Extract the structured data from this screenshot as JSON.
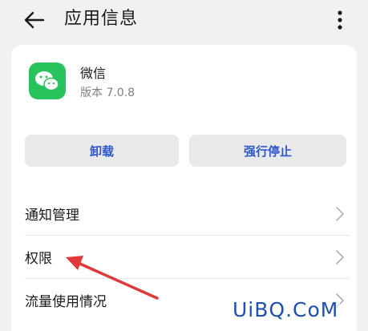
{
  "header": {
    "title": "应用信息",
    "back_icon": "back-arrow-icon",
    "more_icon": "more-vertical-icon"
  },
  "app": {
    "name": "微信",
    "version": "版本 7.0.8",
    "icon": "wechat-icon",
    "icon_color": "#29c35d"
  },
  "buttons": {
    "uninstall": "卸载",
    "force_stop": "强行停止",
    "accent": "#2f57cc"
  },
  "rows": [
    {
      "label": "通知管理"
    },
    {
      "label": "权限"
    },
    {
      "label": "流量使用情况"
    }
  ],
  "annotation": {
    "arrow_color": "#e0393a",
    "watermark": "UiBQ.CoM"
  }
}
